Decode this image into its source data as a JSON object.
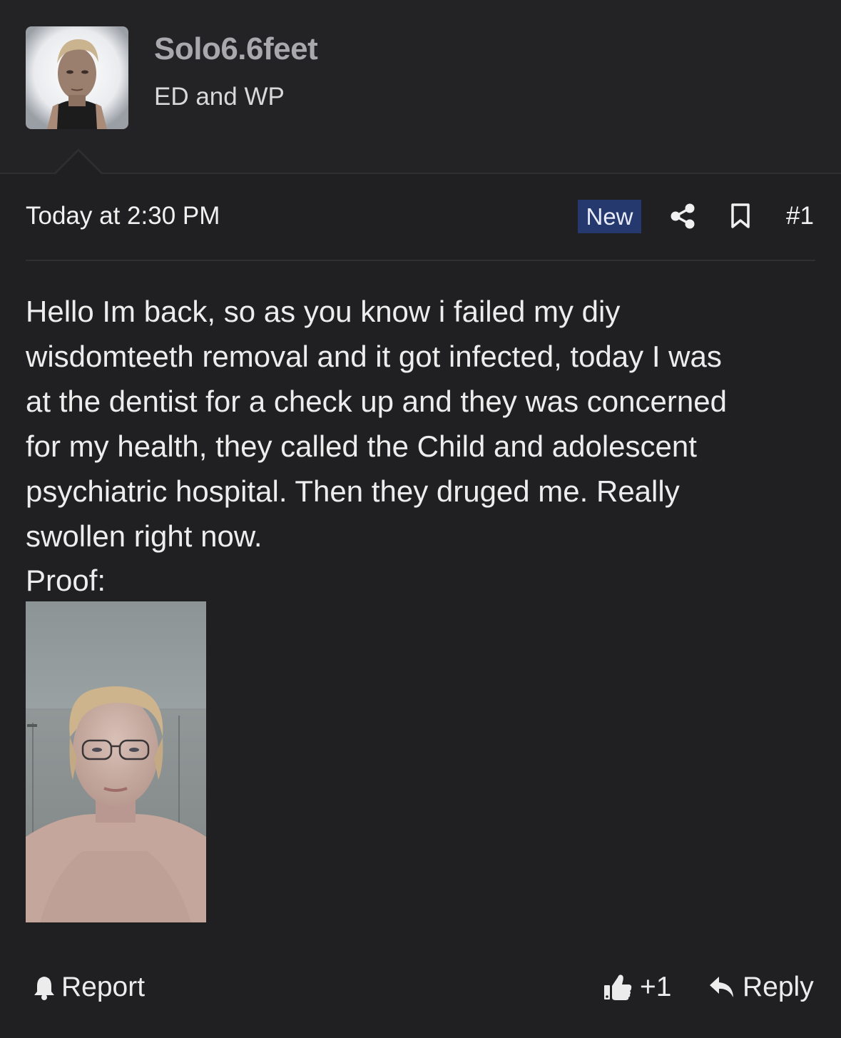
{
  "author": {
    "username": "Solo6.6feet",
    "user_title": "ED and WP"
  },
  "post": {
    "date": "Today at 2:30 PM",
    "new_badge": "New",
    "post_number": "#1",
    "body": "Hello Im back, so as you know i failed my diy\nwisdomteeth removal and it got infected, today I was\nat the dentist for a check up and they was concerned\nfor my health, they called the Child and adolescent\npsychiatric hospital. Then they druged me. Really\nswollen right now.",
    "proof_label": "Proof:"
  },
  "footer": {
    "report_label": "Report",
    "like_count": "+1",
    "reply_label": "Reply"
  },
  "icons": {
    "share": "share-icon",
    "bookmark": "bookmark-icon",
    "report": "bell-icon",
    "like": "thumbs-up-icon",
    "reply": "reply-arrow-icon"
  },
  "colors": {
    "background": "#202022",
    "new_badge": "#25396f",
    "username": "#a9a9ad"
  }
}
